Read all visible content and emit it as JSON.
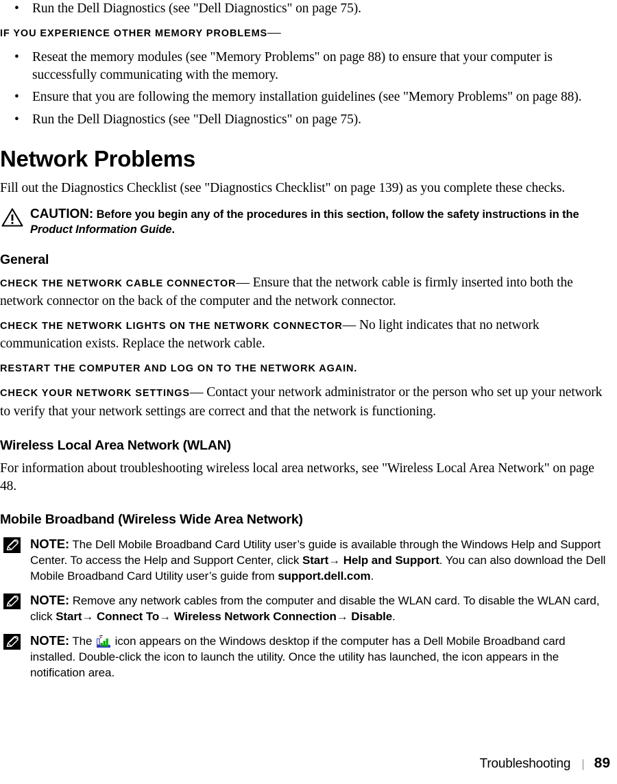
{
  "page": {
    "footer": {
      "section_title": "Troubleshooting",
      "separator": "|",
      "page_number": "89"
    }
  },
  "memory_section": {
    "top_bullet": "Run the Dell Diagnostics (see \"Dell Diagnostics\" on page 75).",
    "runin_heading": "IF YOU EXPERIENCE OTHER MEMORY PROBLEMS",
    "runin_dash": "—",
    "bullets": [
      "Reseat the memory modules (see \"Memory Problems\" on page 88) to ensure that your computer is successfully communicating with the memory.",
      "Ensure that you are following the memory installation guidelines (see \"Memory Problems\" on page 88).",
      "Run the Dell Diagnostics (see \"Dell Diagnostics\" on page 75)."
    ]
  },
  "network_section": {
    "title": "Network Problems",
    "intro": "Fill out the Diagnostics Checklist (see \"Diagnostics Checklist\" on page 139) as you complete these checks.",
    "caution": {
      "icon": "warning-triangle-icon",
      "label": "CAUTION:",
      "text_before_italic": "Before you begin any of the procedures in this section, follow the safety instructions in the ",
      "italic_text": "Product Information Guide",
      "text_after_italic": "."
    },
    "general": {
      "title": "General",
      "items": [
        {
          "heading": "CHECK THE NETWORK CABLE CONNECTOR",
          "dash": "—",
          "body": "Ensure that the network cable is firmly inserted into both the network connector on the back of the computer and the network connector."
        },
        {
          "heading": "CHECK THE NETWORK LIGHTS ON THE NETWORK CONNECTOR",
          "dash": "—",
          "body": "No light indicates that no network communication exists. Replace the network cable."
        },
        {
          "heading": "RESTART THE COMPUTER AND LOG ON TO THE NETWORK AGAIN.",
          "dash": "",
          "body": ""
        },
        {
          "heading": "CHECK YOUR NETWORK SETTINGS",
          "dash": "—",
          "body": "Contact your network administrator or the person who set up your network to verify that your network settings are correct and that the network is functioning."
        }
      ]
    },
    "wlan": {
      "title": "Wireless Local Area Network (WLAN)",
      "body": "For information about troubleshooting wireless local area networks, see \"Wireless Local Area Network\" on page 48."
    },
    "mobile_broadband": {
      "title": "Mobile Broadband (Wireless Wide Area Network)",
      "notes": [
        {
          "icon": "note-pencil-icon",
          "label": "NOTE:",
          "seg1": "The Dell Mobile Broadband Card Utility user’s guide is available through the Windows Help and Support Center. To access the Help and Support Center, click ",
          "bold1": "Start→ Help and Support",
          "seg2": ". You can also download the Dell Mobile Broadband Card Utility user’s guide from ",
          "bold2": "support.dell.com",
          "seg3": "."
        },
        {
          "icon": "note-pencil-icon",
          "label": "NOTE:",
          "seg1": "Remove any network cables from the computer and disable the WLAN card. To disable the WLAN card, click ",
          "bold1": "Start→ Connect To→ Wireless Network Connection→ Disable",
          "seg2": ".",
          "bold2": "",
          "seg3": ""
        },
        {
          "icon": "note-pencil-icon",
          "label": "NOTE:",
          "inline_icon": "signal-bars-icon",
          "seg1": "The ",
          "seg2": " icon appears on the Windows desktop if the computer has a Dell Mobile Broadband card installed. Double-click the icon to launch the utility. Once the utility has launched, the icon appears in the notification area.",
          "bold1": "",
          "bold2": "",
          "seg3": ""
        }
      ]
    }
  },
  "colors": {
    "text": "#000000",
    "page_background": "#ffffff",
    "footer_separator": "#9a9a9a",
    "signal_icon_green": "#00b000",
    "signal_icon_blue": "#3a3ad0"
  }
}
